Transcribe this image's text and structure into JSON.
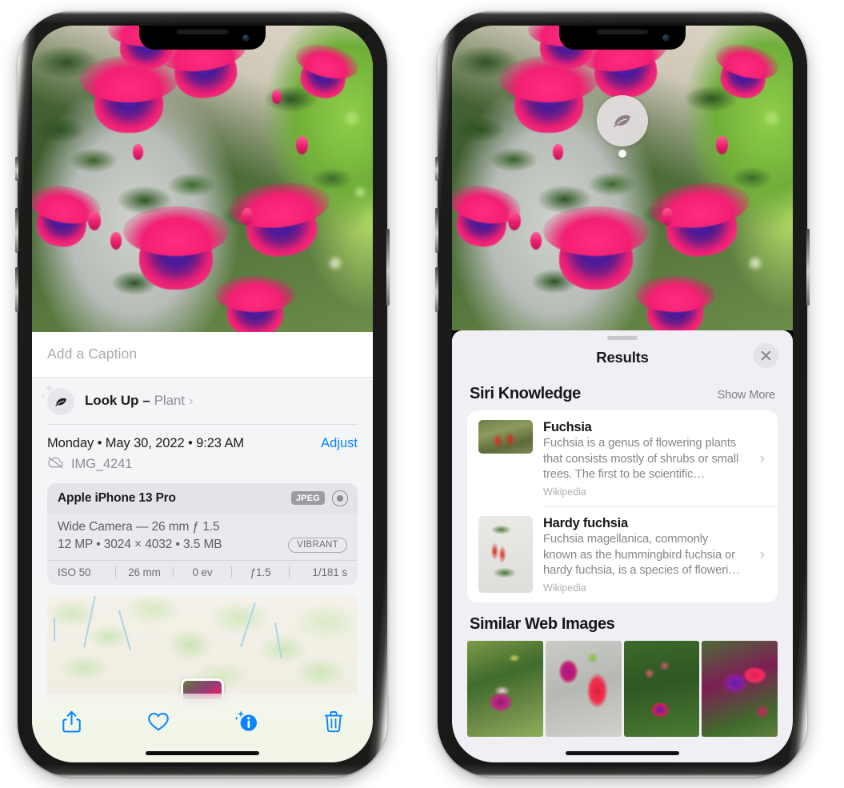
{
  "left_phone": {
    "photo": {
      "alt": "fuchsia-flowers-photo"
    },
    "caption_field": {
      "placeholder": "Add a Caption",
      "value": ""
    },
    "look_up": {
      "icon": "leaf-icon",
      "label": "Look Up",
      "dash": "–",
      "subject": "Plant",
      "chevron": "›"
    },
    "date_row": {
      "date": "Monday • May 30, 2022 • 9:23 AM",
      "adjust_label": "Adjust"
    },
    "filename_row": {
      "icon": "icloud-slash-icon",
      "filename": "IMG_4241"
    },
    "exif": {
      "device": "Apple iPhone 13 Pro",
      "format_chip": "JPEG",
      "lens_icon": "lens-icon",
      "lens_line": "Wide Camera — 26 mm ƒ 1.5",
      "size_line": "12 MP • 3024 × 4032 • 3.5 MB",
      "style_chip": "VIBRANT",
      "stats": [
        "ISO 50",
        "26 mm",
        "0 ev",
        "ƒ1.5",
        "1/181 s"
      ]
    },
    "map": {
      "name": "location-map-card",
      "pin": "photo-thumbnail-pin"
    },
    "toolbar": [
      {
        "name": "share-button",
        "icon": "share-icon"
      },
      {
        "name": "favorite-button",
        "icon": "heart-icon"
      },
      {
        "name": "info-button",
        "icon": "info-sparkle-icon"
      },
      {
        "name": "delete-button",
        "icon": "trash-icon"
      }
    ]
  },
  "right_phone": {
    "photo": {
      "alt": "fuchsia-flowers-photo"
    },
    "visual_lookup_badge": {
      "icon": "leaf-icon"
    },
    "sheet": {
      "grabber": "drag-handle",
      "title": "Results",
      "close_icon": "close-icon"
    },
    "siri_knowledge": {
      "title": "Siri Knowledge",
      "show_more": "Show More",
      "items": [
        {
          "title": "Fuchsia",
          "description": "Fuchsia is a genus of flowering plants that consists mostly of shrubs or small trees. The first to be scientific…",
          "source": "Wikipedia",
          "chevron": "›"
        },
        {
          "title": "Hardy fuchsia",
          "description": "Fuchsia magellanica, commonly known as the hummingbird fuchsia or hardy fuchsia, is a species of floweri…",
          "source": "Wikipedia",
          "chevron": "›"
        }
      ]
    },
    "similar_web_images": {
      "title": "Similar Web Images",
      "thumbnails": [
        "fuchsia-web-image-1",
        "fuchsia-web-image-2",
        "fuchsia-web-image-3",
        "fuchsia-web-image-4"
      ]
    }
  },
  "colors": {
    "accent_blue": "#0a84ff",
    "sheet_bg": "#f0f0f4",
    "info_bg": "#f4f5f7",
    "card_bg": "#ffffff",
    "exif_card_bg": "#e9eaed",
    "secondary_text": "#8e8e93"
  }
}
